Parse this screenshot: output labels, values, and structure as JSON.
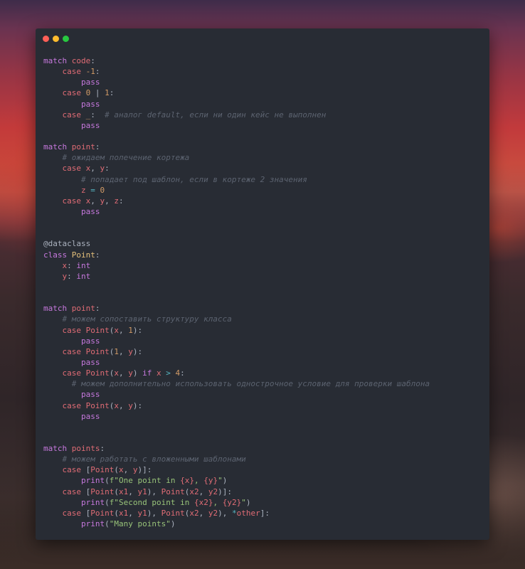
{
  "colors": {
    "window_bg": "#282c34",
    "close": "#ff5f57",
    "minimize": "#febc2e",
    "maximize": "#28c840",
    "keyword": "#c678dd",
    "name": "#e06c75",
    "number": "#d19a66",
    "comment": "#5c6370",
    "class": "#e5c07b",
    "builtin": "#56b6c2",
    "string": "#98c379",
    "plain": "#abb2bf"
  },
  "window": {
    "buttons": [
      "close-dot",
      "minimize-dot",
      "maximize-dot"
    ]
  },
  "code": [
    [
      [
        "keyword",
        "match "
      ],
      [
        "name",
        "code"
      ],
      [
        "plain",
        ":"
      ]
    ],
    [
      [
        "plain",
        "    "
      ],
      [
        "name",
        "case "
      ],
      [
        "number",
        "-1"
      ],
      [
        "plain",
        ":"
      ]
    ],
    [
      [
        "plain",
        "        "
      ],
      [
        "keyword",
        "pass"
      ]
    ],
    [
      [
        "plain",
        "    "
      ],
      [
        "name",
        "case "
      ],
      [
        "number",
        "0"
      ],
      [
        "plain",
        " | "
      ],
      [
        "number",
        "1"
      ],
      [
        "plain",
        ":"
      ]
    ],
    [
      [
        "plain",
        "        "
      ],
      [
        "keyword",
        "pass"
      ]
    ],
    [
      [
        "plain",
        "    "
      ],
      [
        "name",
        "case "
      ],
      [
        "number",
        "_"
      ],
      [
        "plain",
        ":  "
      ],
      [
        "comment",
        "# аналог default, если ни один кейс не выполнен"
      ]
    ],
    [
      [
        "plain",
        "        "
      ],
      [
        "keyword",
        "pass"
      ]
    ],
    [],
    [
      [
        "keyword",
        "match "
      ],
      [
        "name",
        "point"
      ],
      [
        "plain",
        ":"
      ]
    ],
    [
      [
        "plain",
        "    "
      ],
      [
        "comment",
        "# ожидаем полечение кортежа"
      ]
    ],
    [
      [
        "plain",
        "    "
      ],
      [
        "name",
        "case x"
      ],
      [
        "plain",
        ", "
      ],
      [
        "name",
        "y"
      ],
      [
        "plain",
        ":"
      ]
    ],
    [
      [
        "plain",
        "        "
      ],
      [
        "comment",
        "# попадает под шаблон, если в кортеже 2 значения"
      ]
    ],
    [
      [
        "plain",
        "        "
      ],
      [
        "name",
        "z"
      ],
      [
        "plain",
        " "
      ],
      [
        "builtin",
        "="
      ],
      [
        "plain",
        " "
      ],
      [
        "number",
        "0"
      ]
    ],
    [
      [
        "plain",
        "    "
      ],
      [
        "name",
        "case x"
      ],
      [
        "plain",
        ", "
      ],
      [
        "name",
        "y"
      ],
      [
        "plain",
        ", "
      ],
      [
        "name",
        "z"
      ],
      [
        "plain",
        ":"
      ]
    ],
    [
      [
        "plain",
        "        "
      ],
      [
        "keyword",
        "pass"
      ]
    ],
    [],
    [],
    [
      [
        "decorator",
        "@dataclass"
      ]
    ],
    [
      [
        "keyword",
        "class "
      ],
      [
        "class",
        "Point"
      ],
      [
        "plain",
        ":"
      ]
    ],
    [
      [
        "plain",
        "    "
      ],
      [
        "name",
        "x"
      ],
      [
        "plain",
        ": "
      ],
      [
        "keyword",
        "int"
      ]
    ],
    [
      [
        "plain",
        "    "
      ],
      [
        "name",
        "y"
      ],
      [
        "plain",
        ": "
      ],
      [
        "keyword",
        "int"
      ]
    ],
    [],
    [],
    [
      [
        "keyword",
        "match "
      ],
      [
        "name",
        "point"
      ],
      [
        "plain",
        ":"
      ]
    ],
    [
      [
        "plain",
        "    "
      ],
      [
        "comment",
        "# можем сопоставить структуру класса"
      ]
    ],
    [
      [
        "plain",
        "    "
      ],
      [
        "name",
        "case Point"
      ],
      [
        "plain",
        "("
      ],
      [
        "name",
        "x"
      ],
      [
        "plain",
        ", "
      ],
      [
        "number",
        "1"
      ],
      [
        "plain",
        "):"
      ]
    ],
    [
      [
        "plain",
        "        "
      ],
      [
        "keyword",
        "pass"
      ]
    ],
    [
      [
        "plain",
        "    "
      ],
      [
        "name",
        "case Point"
      ],
      [
        "plain",
        "("
      ],
      [
        "number",
        "1"
      ],
      [
        "plain",
        ", "
      ],
      [
        "name",
        "y"
      ],
      [
        "plain",
        "):"
      ]
    ],
    [
      [
        "plain",
        "        "
      ],
      [
        "keyword",
        "pass"
      ]
    ],
    [
      [
        "plain",
        "    "
      ],
      [
        "name",
        "case Point"
      ],
      [
        "plain",
        "("
      ],
      [
        "name",
        "x"
      ],
      [
        "plain",
        ", "
      ],
      [
        "name",
        "y"
      ],
      [
        "plain",
        ") "
      ],
      [
        "keyword",
        "if "
      ],
      [
        "name",
        "x"
      ],
      [
        "plain",
        " "
      ],
      [
        "builtin",
        ">"
      ],
      [
        "plain",
        " "
      ],
      [
        "number",
        "4"
      ],
      [
        "plain",
        ":"
      ]
    ],
    [
      [
        "plain",
        "      "
      ],
      [
        "comment",
        "# можем дополнительно использовать однострочное условие для проверки шаблона"
      ]
    ],
    [
      [
        "plain",
        "        "
      ],
      [
        "keyword",
        "pass"
      ]
    ],
    [
      [
        "plain",
        "    "
      ],
      [
        "name",
        "case Point"
      ],
      [
        "plain",
        "("
      ],
      [
        "name",
        "x"
      ],
      [
        "plain",
        ", "
      ],
      [
        "name",
        "y"
      ],
      [
        "plain",
        "):"
      ]
    ],
    [
      [
        "plain",
        "        "
      ],
      [
        "keyword",
        "pass"
      ]
    ],
    [],
    [],
    [
      [
        "keyword",
        "match "
      ],
      [
        "name",
        "points"
      ],
      [
        "plain",
        ":"
      ]
    ],
    [
      [
        "plain",
        "    "
      ],
      [
        "comment",
        "# можем работать с вложенными шаблонами"
      ]
    ],
    [
      [
        "plain",
        "    "
      ],
      [
        "name",
        "case "
      ],
      [
        "plain",
        "["
      ],
      [
        "name",
        "Point"
      ],
      [
        "plain",
        "("
      ],
      [
        "name",
        "x"
      ],
      [
        "plain",
        ", "
      ],
      [
        "name",
        "y"
      ],
      [
        "plain",
        ")]:"
      ]
    ],
    [
      [
        "plain",
        "        "
      ],
      [
        "keyword",
        "print"
      ],
      [
        "plain",
        "("
      ],
      [
        "string",
        "f\"One point in "
      ],
      [
        "name",
        "{x}"
      ],
      [
        "string",
        ", "
      ],
      [
        "name",
        "{y}"
      ],
      [
        "string",
        "\""
      ],
      [
        "plain",
        ")"
      ]
    ],
    [
      [
        "plain",
        "    "
      ],
      [
        "name",
        "case "
      ],
      [
        "plain",
        "["
      ],
      [
        "name",
        "Point"
      ],
      [
        "plain",
        "("
      ],
      [
        "name",
        "x1"
      ],
      [
        "plain",
        ", "
      ],
      [
        "name",
        "y1"
      ],
      [
        "plain",
        "), "
      ],
      [
        "name",
        "Point"
      ],
      [
        "plain",
        "("
      ],
      [
        "name",
        "x2"
      ],
      [
        "plain",
        ", "
      ],
      [
        "name",
        "y2"
      ],
      [
        "plain",
        ")]:"
      ]
    ],
    [
      [
        "plain",
        "        "
      ],
      [
        "keyword",
        "print"
      ],
      [
        "plain",
        "("
      ],
      [
        "string",
        "f\"Second point in "
      ],
      [
        "name",
        "{x2}"
      ],
      [
        "string",
        ", "
      ],
      [
        "name",
        "{y2}"
      ],
      [
        "string",
        "\""
      ],
      [
        "plain",
        ")"
      ]
    ],
    [
      [
        "plain",
        "    "
      ],
      [
        "name",
        "case "
      ],
      [
        "plain",
        "["
      ],
      [
        "name",
        "Point"
      ],
      [
        "plain",
        "("
      ],
      [
        "name",
        "x1"
      ],
      [
        "plain",
        ", "
      ],
      [
        "name",
        "y1"
      ],
      [
        "plain",
        "), "
      ],
      [
        "name",
        "Point"
      ],
      [
        "plain",
        "("
      ],
      [
        "name",
        "x2"
      ],
      [
        "plain",
        ", "
      ],
      [
        "name",
        "y2"
      ],
      [
        "plain",
        "), "
      ],
      [
        "builtin",
        "*"
      ],
      [
        "name",
        "other"
      ],
      [
        "plain",
        "]:"
      ]
    ],
    [
      [
        "plain",
        "        "
      ],
      [
        "keyword",
        "print"
      ],
      [
        "plain",
        "("
      ],
      [
        "string",
        "\"Many points\""
      ],
      [
        "plain",
        ")"
      ]
    ]
  ]
}
